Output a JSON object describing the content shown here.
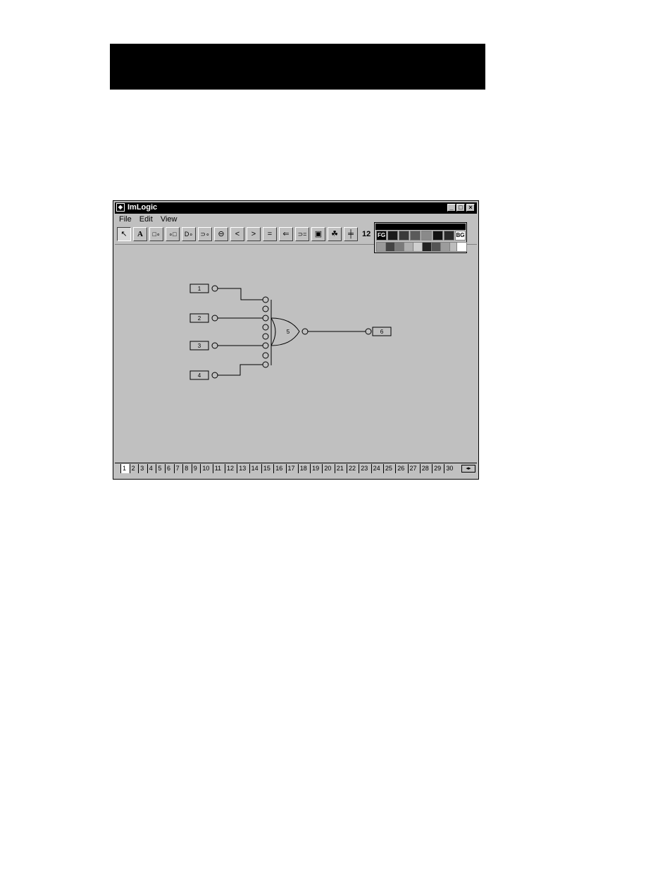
{
  "window": {
    "title": "ImLogic",
    "min_glyph": "_",
    "max_glyph": "□",
    "close_glyph": "×"
  },
  "menu": [
    "File",
    "Edit",
    "View"
  ],
  "toolbar": {
    "tools": [
      {
        "name": "select-tool",
        "glyph": "↖"
      },
      {
        "name": "text-tool",
        "glyph": "A"
      },
      {
        "name": "input-tool",
        "glyph": "□∘"
      },
      {
        "name": "output-tool",
        "glyph": "∘□"
      },
      {
        "name": "and-gate-tool",
        "glyph": "D∘"
      },
      {
        "name": "or-gate-tool",
        "glyph": "⊃∘"
      },
      {
        "name": "wire-tool",
        "glyph": "⊖"
      },
      {
        "name": "left-angle-tool",
        "glyph": "<"
      },
      {
        "name": "right-angle-tool",
        "glyph": ">"
      },
      {
        "name": "equal-tool",
        "glyph": "="
      },
      {
        "name": "left-arrow-tool",
        "glyph": "⇐"
      },
      {
        "name": "ge-tool",
        "glyph": "⊃="
      },
      {
        "name": "page-tool",
        "glyph": "▣"
      },
      {
        "name": "component-tool",
        "glyph": "☘"
      },
      {
        "name": "junction-tool",
        "glyph": "╪"
      }
    ],
    "zoom": "12"
  },
  "palette": {
    "fg_label": "FG",
    "bg_label": "BG",
    "row1": [
      "#1a1a1a",
      "#3a3a3a",
      "#5a5a5a",
      "#8a8a8a",
      "#111111",
      "#2a2a2a",
      "#4c4c4c"
    ],
    "row2": [
      "#9a9a9a",
      "#444444",
      "#7a7a7a",
      "#b0b0b0",
      "#cfcfcf",
      "#222222",
      "#555555",
      "#9c9c9c",
      "#bdbdbd",
      "#ffffff"
    ]
  },
  "circuit": {
    "inputs": [
      "1",
      "2",
      "3",
      "4"
    ],
    "gate_label": "5",
    "output": "6"
  },
  "tabs": [
    "1",
    "2",
    "3",
    "4",
    "5",
    "6",
    "7",
    "8",
    "9",
    "10",
    "11",
    "12",
    "13",
    "14",
    "15",
    "16",
    "17",
    "18",
    "19",
    "20",
    "21",
    "22",
    "23",
    "24",
    "25",
    "26",
    "27",
    "28",
    "29",
    "30"
  ],
  "active_tab": "1"
}
